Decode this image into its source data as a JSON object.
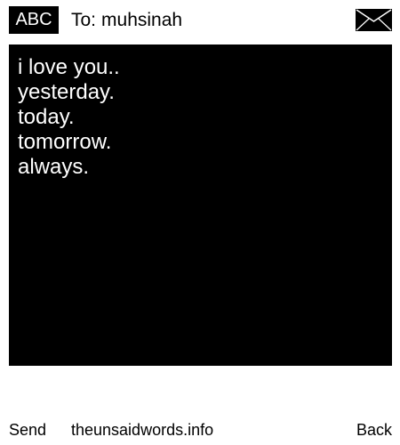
{
  "header": {
    "input_mode": "ABC",
    "to_label": "To:",
    "recipient": "muhsinah",
    "envelope_icon": "envelope-icon"
  },
  "message": {
    "lines": [
      "i love you..",
      "yesterday.",
      "today.",
      "tomorrow.",
      "always."
    ]
  },
  "footer": {
    "send_label": "Send",
    "site_label": "theunsaidwords.info",
    "back_label": "Back"
  },
  "colors": {
    "background": "#ffffff",
    "panel": "#000000",
    "text_on_panel": "#ffffff"
  }
}
